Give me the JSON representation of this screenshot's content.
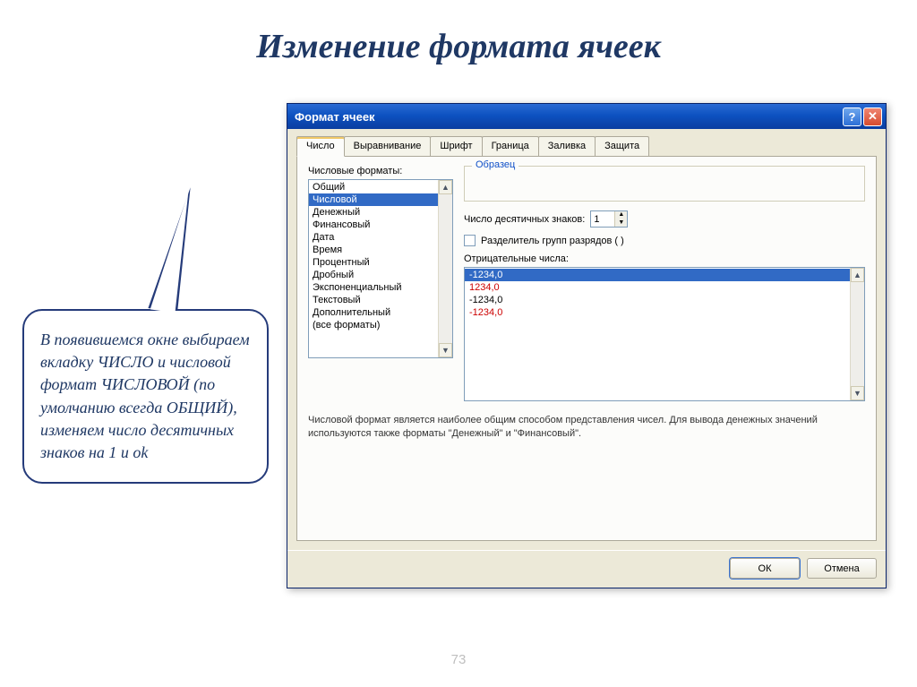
{
  "slide": {
    "title": "Изменение формата ячеек",
    "page_number": "73"
  },
  "callout": {
    "text": "В появившемся окне выбираем вкладку  ЧИСЛО и числовой формат ЧИСЛОВОЙ (по умолчанию всегда ОБЩИЙ), изменяем число десятичных знаков на 1 и ok"
  },
  "dialog": {
    "title": "Формат ячеек",
    "tabs": [
      "Число",
      "Выравнивание",
      "Шрифт",
      "Граница",
      "Заливка",
      "Защита"
    ],
    "active_tab": 0,
    "formats_label": "Числовые форматы:",
    "format_items": [
      "Общий",
      "Числовой",
      "Денежный",
      "Финансовый",
      "Дата",
      "Время",
      "Процентный",
      "Дробный",
      "Экспоненциальный",
      "Текстовый",
      "Дополнительный",
      "(все форматы)"
    ],
    "selected_format_index": 1,
    "sample_legend": "Образец",
    "decimals_label": "Число десятичных знаков:",
    "decimals_value": "1",
    "separator_label": "Разделитель групп разрядов ( )",
    "negatives_label": "Отрицательные числа:",
    "negative_items": [
      {
        "text": "-1234,0",
        "red": false,
        "selected": true
      },
      {
        "text": "1234,0",
        "red": true,
        "selected": false
      },
      {
        "text": "-1234,0",
        "red": false,
        "selected": false
      },
      {
        "text": "-1234,0",
        "red": true,
        "selected": false
      }
    ],
    "description": "Числовой формат является наиболее общим способом представления чисел. Для вывода денежных значений используются также форматы \"Денежный\" и \"Финансовый\".",
    "ok_label": "ОК",
    "cancel_label": "Отмена"
  }
}
